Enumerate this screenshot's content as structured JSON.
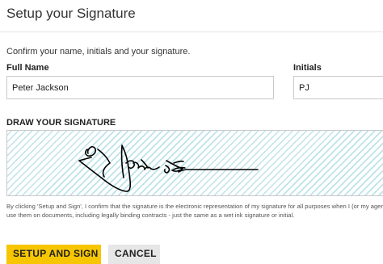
{
  "dialog": {
    "title": "Setup your Signature",
    "intro": "Confirm your name, initials and your signature.",
    "full_name": {
      "label": "Full Name",
      "value": "Peter Jackson"
    },
    "initials": {
      "label": "Initials",
      "value": "PJ"
    },
    "signature": {
      "label": "DRAW YOUR SIGNATURE",
      "stroke_color": "#000000",
      "pad_stripe_color": "#bde3ea"
    },
    "disclaimer": "By clicking 'Setup and Sign', I confirm that the signature is the electronic representation of my signature for all purposes when I (or my agent) use them on documents, including legally binding contracts - just the same as a wet ink signature or initial.",
    "buttons": {
      "primary": "SETUP AND SIGN",
      "secondary": "CANCEL"
    },
    "colors": {
      "primary_button": "#f7c600",
      "secondary_button": "#e6e6e6"
    }
  }
}
